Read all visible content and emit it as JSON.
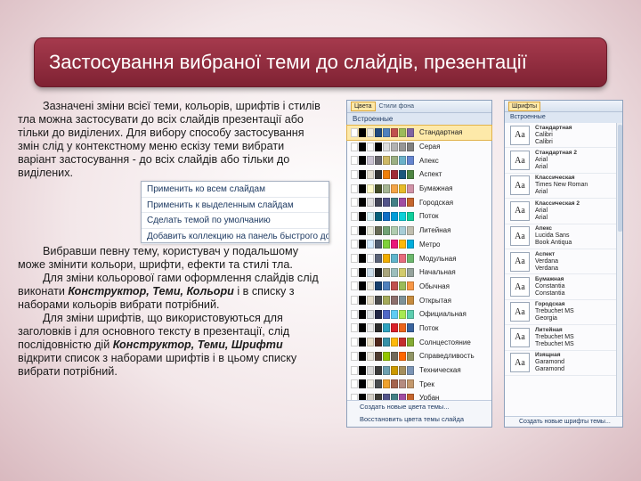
{
  "slide": {
    "title": "Застосування вибраної теми до слайдів, презентації",
    "para1": "Зазначені зміни всієї теми, кольорів, шрифтів і стилів тла можна застосувати до всіх слайдів презентації або тільки до виділених. Для вибору способу застосування змін слід у контекстному меню ескізу теми вибрати варіант застосування - до всіх слайдів або тільки до виділених.",
    "para2": "Вибравши певну тему, користувач у подальшому може змінити кольори, шрифти, ефекти та стилі тла.",
    "para3_a": "Для зміни кольорової гами оформлення слайдів слід виконати ",
    "para3_b": "Конструктор, Теми, Кольори",
    "para3_c": " і в списку з наборами кольорів вибрати потрібний.",
    "para4_a": "Для зміни шрифтів, що використовуються для заголовків і для основного тексту в презентації, слід послідовністю дій ",
    "para4_b": "Конструктор, Теми, Шрифти",
    "para4_c": " відкрити список з наборами шрифтів і в цьому списку вибрати потрібний."
  },
  "context_menu": {
    "items": [
      "Применить ко всем слайдам",
      "Применить к выделенным слайдам",
      "Сделать темой по умолчанию",
      "Добавить коллекцию на панель быстрого доступа"
    ]
  },
  "colors_gallery": {
    "ribbon_button": "Цвета",
    "ribbon_button2": "Стили фона",
    "header": "Встроенные",
    "rows": [
      {
        "name": "Стандартная",
        "colors": [
          "#ffffff",
          "#000000",
          "#eeece1",
          "#1f497d",
          "#4f81bd",
          "#c0504d",
          "#9bbb59",
          "#8064a2"
        ]
      },
      {
        "name": "Серая",
        "colors": [
          "#ffffff",
          "#000000",
          "#f8f8f8",
          "#000000",
          "#dddddd",
          "#b2b2b2",
          "#969696",
          "#808080"
        ]
      },
      {
        "name": "Апекс",
        "colors": [
          "#ffffff",
          "#000000",
          "#c9c2d1",
          "#69676d",
          "#ceb966",
          "#9cb084",
          "#6bb1c9",
          "#6585cf"
        ]
      },
      {
        "name": "Аспект",
        "colors": [
          "#ffffff",
          "#000000",
          "#e3ded1",
          "#323232",
          "#f07f09",
          "#9f2936",
          "#1b587c",
          "#4e8542"
        ]
      },
      {
        "name": "Бумажная",
        "colors": [
          "#ffffff",
          "#000000",
          "#fefac9",
          "#444d26",
          "#a5b592",
          "#f3a447",
          "#e7bc29",
          "#d092a7"
        ]
      },
      {
        "name": "Городская",
        "colors": [
          "#ffffff",
          "#000000",
          "#dedede",
          "#424456",
          "#53548a",
          "#438086",
          "#a04da3",
          "#c4652d"
        ]
      },
      {
        "name": "Поток",
        "colors": [
          "#ffffff",
          "#000000",
          "#dbf5f9",
          "#04617b",
          "#0f6fc6",
          "#009dd9",
          "#0bd0d9",
          "#10cf9b"
        ]
      },
      {
        "name": "Литейная",
        "colors": [
          "#ffffff",
          "#000000",
          "#eaebde",
          "#676a55",
          "#72a376",
          "#b0ccb0",
          "#a8cdd7",
          "#c0beaf"
        ]
      },
      {
        "name": "Метро",
        "colors": [
          "#ffffff",
          "#000000",
          "#d6ecff",
          "#4e5b6f",
          "#7fd13b",
          "#ea157a",
          "#feb80a",
          "#00addc"
        ]
      },
      {
        "name": "Модульная",
        "colors": [
          "#ffffff",
          "#000000",
          "#fafcff",
          "#5a6378",
          "#f0ad00",
          "#60b5cc",
          "#e66c7d",
          "#6bb76d"
        ]
      },
      {
        "name": "Начальная",
        "colors": [
          "#ffffff",
          "#000000",
          "#ccddea",
          "#1f2123",
          "#a9a57c",
          "#9cbebd",
          "#d2cb6c",
          "#95a39d"
        ]
      },
      {
        "name": "Обычная",
        "colors": [
          "#ffffff",
          "#000000",
          "#eeece1",
          "#17406d",
          "#4f81bd",
          "#c0504d",
          "#9bbb59",
          "#f79646"
        ]
      },
      {
        "name": "Открытая",
        "colors": [
          "#ffffff",
          "#000000",
          "#e3dcc9",
          "#4c4c4c",
          "#a4aa5a",
          "#8d6f6d",
          "#7e9299",
          "#c58b3f"
        ]
      },
      {
        "name": "Официальная",
        "colors": [
          "#ffffff",
          "#000000",
          "#dfe3e5",
          "#212745",
          "#4e67c8",
          "#5eccf3",
          "#a7ea52",
          "#5dceaf"
        ]
      },
      {
        "name": "Поток",
        "colors": [
          "#ffffff",
          "#000000",
          "#ebebeb",
          "#2b2b2b",
          "#2da2bf",
          "#da1f28",
          "#eb641b",
          "#39639d"
        ]
      },
      {
        "name": "Солнцестояние",
        "colors": [
          "#ffffff",
          "#000000",
          "#e7dec9",
          "#4f271c",
          "#3891a7",
          "#feb80a",
          "#c32d2e",
          "#84aa33"
        ]
      },
      {
        "name": "Справедливость",
        "colors": [
          "#ffffff",
          "#000000",
          "#e9e5dc",
          "#4e3b30",
          "#94c600",
          "#71685a",
          "#ff6700",
          "#909465"
        ]
      },
      {
        "name": "Техническая",
        "colors": [
          "#ffffff",
          "#000000",
          "#d8d8d8",
          "#3b3b3b",
          "#6ea0b0",
          "#cc9900",
          "#a48e5d",
          "#7b94b5"
        ]
      },
      {
        "name": "Трек",
        "colors": [
          "#ffffff",
          "#000000",
          "#f2efe6",
          "#4a4d4f",
          "#f0a22e",
          "#a5644e",
          "#b58b80",
          "#c3986d"
        ]
      },
      {
        "name": "Урбан",
        "colors": [
          "#ffffff",
          "#000000",
          "#d4cfc7",
          "#3e3b35",
          "#53548a",
          "#438086",
          "#a04da3",
          "#c4652d"
        ]
      },
      {
        "name": "Эркер",
        "colors": [
          "#ffffff",
          "#000000",
          "#ebddc3",
          "#5b3f2e",
          "#b6a272",
          "#d5a54e",
          "#a49268",
          "#8a6b3f"
        ]
      }
    ],
    "footer": [
      "Создать новые цвета темы...",
      "Восстановить цвета темы слайда"
    ]
  },
  "fonts_gallery": {
    "ribbon_button": "Шрифты",
    "header": "Встроенные",
    "rows": [
      {
        "title": "Стандартная",
        "heading": "Calibri",
        "body": "Calibri"
      },
      {
        "title": "Стандартная 2",
        "heading": "Arial",
        "body": "Arial"
      },
      {
        "title": "Классическая",
        "heading": "Times New Roman",
        "body": "Arial"
      },
      {
        "title": "Классическая 2",
        "heading": "Arial",
        "body": "Arial"
      },
      {
        "title": "Апекс",
        "heading": "Lucida Sans",
        "body": "Book Antiqua"
      },
      {
        "title": "Аспект",
        "heading": "Verdana",
        "body": "Verdana"
      },
      {
        "title": "Бумажная",
        "heading": "Constantia",
        "body": "Constantia"
      },
      {
        "title": "Городская",
        "heading": "Trebuchet MS",
        "body": "Georgia"
      },
      {
        "title": "Литейная",
        "heading": "Trebuchet MS",
        "body": "Trebuchet MS"
      },
      {
        "title": "Изящная",
        "heading": "Garamond",
        "body": "Garamond"
      }
    ],
    "aa_label": "Aa",
    "footer": "Создать новые шрифты темы..."
  }
}
